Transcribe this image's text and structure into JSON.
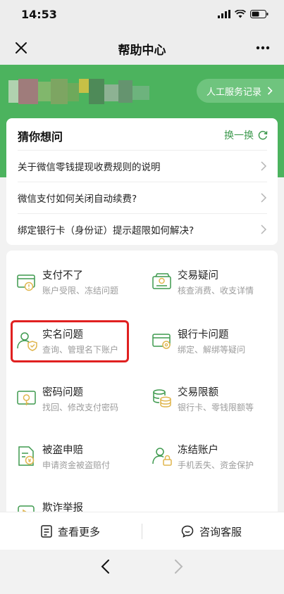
{
  "status": {
    "time": "14:53"
  },
  "nav": {
    "title": "帮助中心"
  },
  "header": {
    "service_record_label": "人工服务记录"
  },
  "guess": {
    "title": "猜你想问",
    "refresh_label": "换一换",
    "questions": [
      "关于微信零钱提现收费规则的说明",
      "微信支付如何关闭自动续费?",
      "绑定银行卡（身份证）提示超限如何解决?"
    ]
  },
  "categories": [
    {
      "title": "支付不了",
      "subtitle": "账户受限、冻结问题",
      "icon": "card-alert-icon"
    },
    {
      "title": "交易疑问",
      "subtitle": "核查消费、收支详情",
      "icon": "wallet-icon"
    },
    {
      "title": "实名问题",
      "subtitle": "查询、管理名下账户",
      "icon": "user-shield-icon"
    },
    {
      "title": "银行卡问题",
      "subtitle": "绑定、解绑等疑问",
      "icon": "bank-card-icon"
    },
    {
      "title": "密码问题",
      "subtitle": "找回、修改支付密码",
      "icon": "lock-icon"
    },
    {
      "title": "交易限额",
      "subtitle": "银行卡、零钱限额等",
      "icon": "coins-icon"
    },
    {
      "title": "被盗申赔",
      "subtitle": "申请资金被盗赔付",
      "icon": "claim-document-icon"
    },
    {
      "title": "冻结账户",
      "subtitle": "手机丢失、资金保护",
      "icon": "user-lock-icon"
    },
    {
      "title": "欺诈举报",
      "subtitle": "",
      "icon": "report-icon"
    }
  ],
  "bottom": {
    "more_label": "查看更多",
    "service_label": "咨询客服"
  },
  "colors": {
    "brand_green": "#4cb35e",
    "accent_green": "#3f9a4f",
    "highlight_red": "#e02020"
  }
}
